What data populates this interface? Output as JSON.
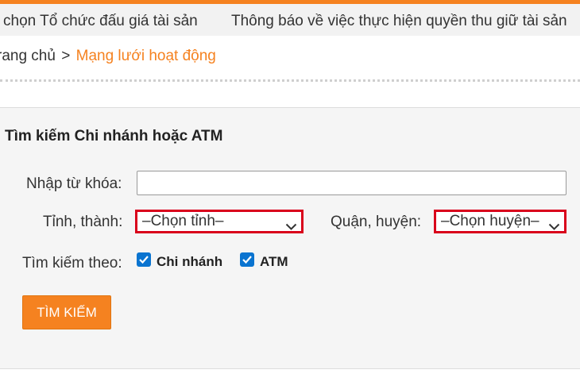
{
  "ticker": {
    "items": [
      "chọn Tổ chức đấu giá tài sản",
      "Thông báo về việc thực hiện quyền thu giữ tài sản"
    ]
  },
  "breadcrumb": {
    "home": "rang chủ",
    "separator": ">",
    "current": "Mạng lưới hoạt động"
  },
  "search": {
    "title": "Tìm kiếm Chi nhánh hoặc ATM",
    "keyword_label": "Nhập từ khóa:",
    "keyword_value": "",
    "province_label": "Tỉnh, thành:",
    "province_selected": "–Chọn tỉnh–",
    "district_label": "Quận, huyện:",
    "district_selected": "–Chọn huyện–",
    "search_by_label": "Tìm kiếm theo:",
    "options": [
      {
        "label": "Chi nhánh",
        "checked": true
      },
      {
        "label": "ATM",
        "checked": true
      }
    ],
    "button_label": "TÌM KIẾM"
  },
  "colors": {
    "accent": "#f58220",
    "highlight_border": "#d9001b",
    "checkbox": "#0a74d0"
  },
  "icons": [
    "chevron-down-icon",
    "checkmark-icon"
  ]
}
